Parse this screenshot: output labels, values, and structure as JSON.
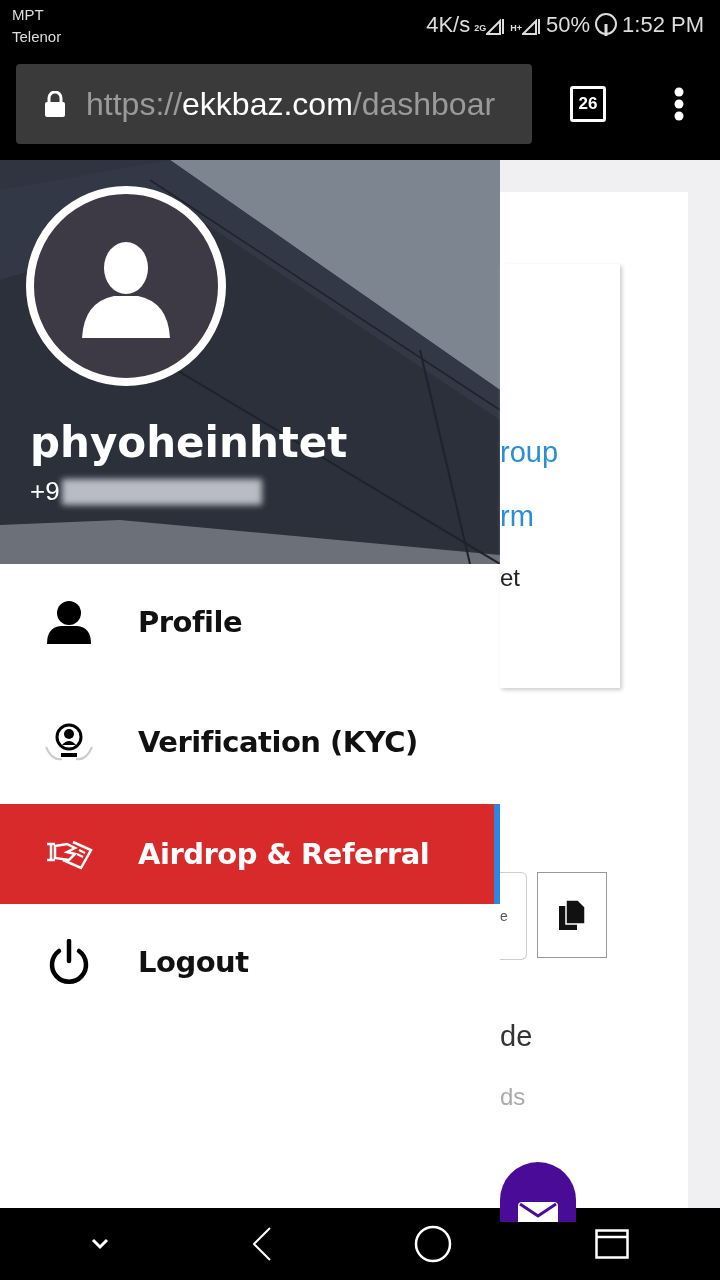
{
  "status_bar": {
    "carriers": [
      "MPT",
      "Telenor"
    ],
    "speed": "4K/s",
    "network_1": "2G",
    "network_2": "H+",
    "battery": "50%",
    "time": "1:52 PM"
  },
  "browser": {
    "url_scheme": "https://",
    "url_host": "ekkbaz.com",
    "url_path": "/dashboar",
    "tab_count": "26"
  },
  "drawer": {
    "username": "phyoheinhtet",
    "phone_visible": "+9",
    "items": [
      {
        "kind": "person",
        "label": "Profile",
        "selected": false
      },
      {
        "kind": "kyc",
        "label": "Verification (KYC)",
        "selected": false
      },
      {
        "kind": "referral",
        "label": "Airdrop & Referral",
        "selected": true
      },
      {
        "kind": "power",
        "label": "Logout",
        "selected": false
      }
    ]
  },
  "page": {
    "link_1": "roup",
    "link_2": "rm",
    "text_1": "et",
    "field_value": "e",
    "text_2": "de",
    "text_3": "ds"
  }
}
